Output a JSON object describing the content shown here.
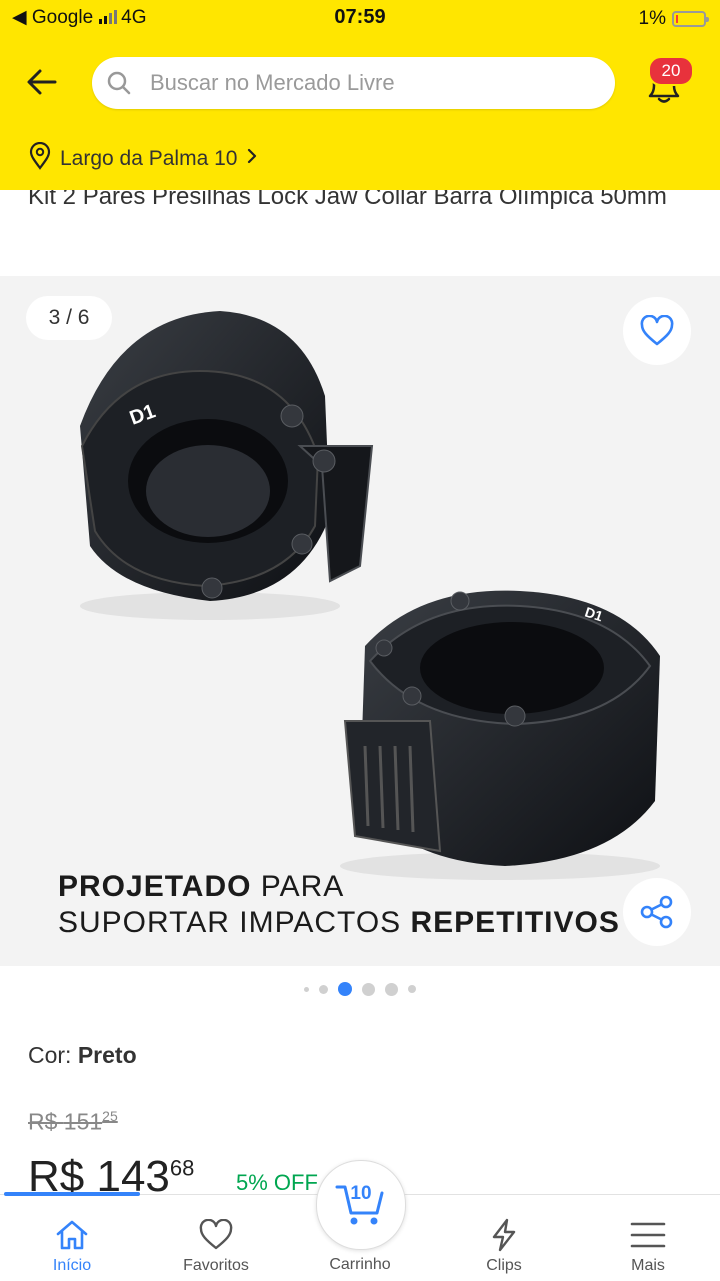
{
  "status_bar": {
    "carrier": "◀ Google",
    "network": "4G",
    "time": "07:59",
    "battery": "1%"
  },
  "header": {
    "search_placeholder": "Buscar no Mercado Livre",
    "notifications_count": "20",
    "location": "Largo da Palma 10"
  },
  "product": {
    "title": "Kit 2 Pares Presilhas Lock Jaw Collar Barra Olímpica 50mm",
    "gallery_counter": "3 / 6",
    "gallery_caption_line1_bold": "PROJETADO",
    "gallery_caption_line1_rest": " PARA",
    "gallery_caption_line2_rest": "SUPORTAR IMPACTOS ",
    "gallery_caption_line2_bold": "REPETITIVOS",
    "image_brand_mark": "D1",
    "gallery_active_index": 2,
    "variant_label": "Cor: ",
    "variant_value": "Preto",
    "old_price_currency": "R$ ",
    "old_price_int": "151",
    "old_price_cents": "25",
    "price_currency": "R$ ",
    "price_int": "143",
    "price_cents": "68",
    "discount": "5% OFF"
  },
  "bottom_nav": {
    "items": [
      {
        "label": "Início",
        "icon": "home-icon"
      },
      {
        "label": "Favoritos",
        "icon": "heart-icon"
      },
      {
        "label": "Carrinho",
        "icon": "cart-icon"
      },
      {
        "label": "Clips",
        "icon": "lightning-icon"
      },
      {
        "label": "Mais",
        "icon": "menu-icon"
      }
    ],
    "cart_count": "10"
  },
  "colors": {
    "brand_yellow": "#ffe600",
    "accent_blue": "#3483fa",
    "discount_green": "#00a650",
    "badge_red": "#e8323c"
  }
}
